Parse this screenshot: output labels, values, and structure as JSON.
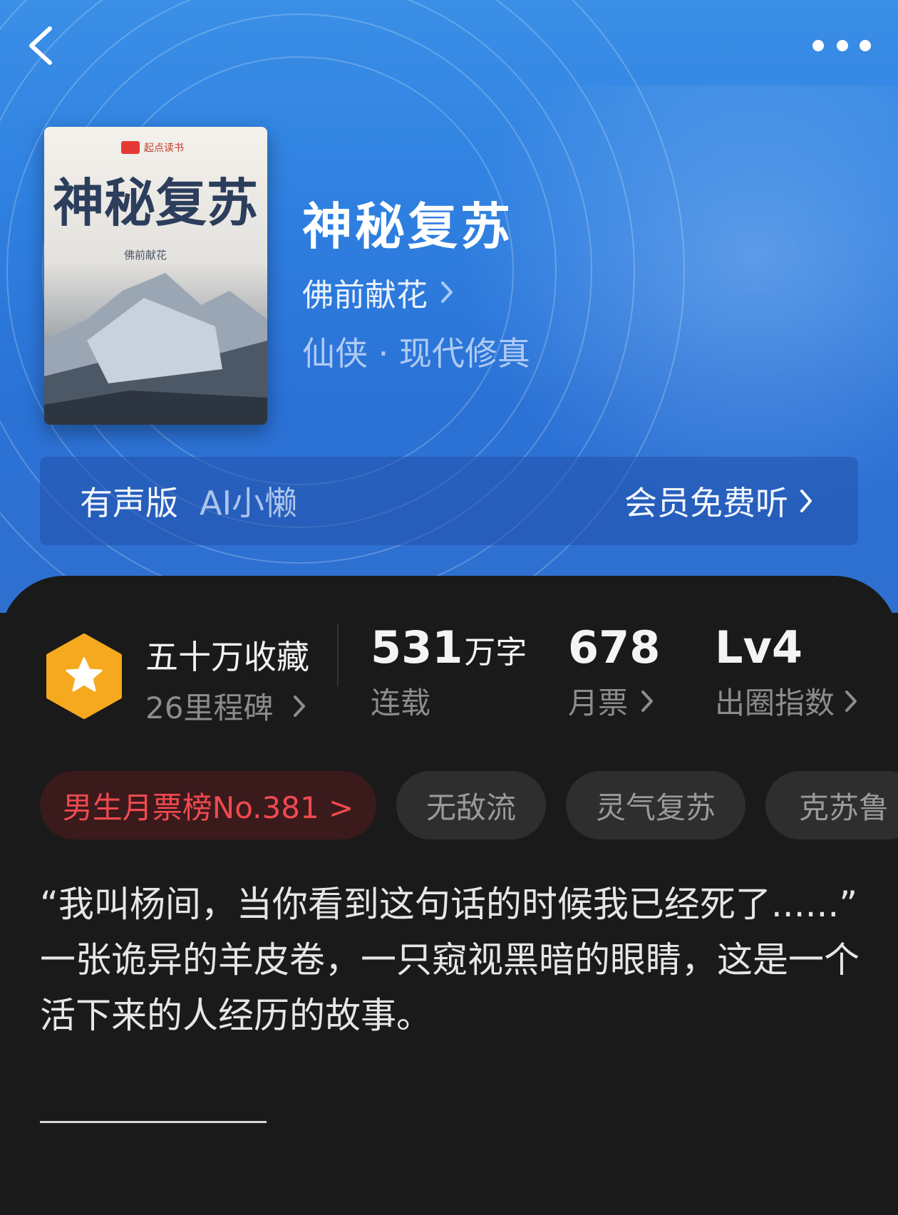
{
  "book": {
    "title": "神秘复苏",
    "author": "佛前献花",
    "genre": "仙侠 · 现代修真",
    "cover": {
      "publisher": "起点读书",
      "title": "神秘复苏",
      "author": "佛前献花"
    }
  },
  "audio": {
    "label": "有声版",
    "voice": "AI小懒",
    "action": "会员免费听"
  },
  "stats": {
    "collect_title": "五十万收藏",
    "milestones": "26里程碑",
    "words_num": "531",
    "words_unit": "万字",
    "status": "连载",
    "monthly_tickets": "678",
    "monthly_label": "月票",
    "level": "Lv4",
    "level_label": "出圈指数"
  },
  "tags": [
    "男生月票榜No.381 >",
    "无敌流",
    "灵气复苏",
    "克苏鲁"
  ],
  "intro": {
    "line1": "“我叫杨间，当你看到这句话的时候我已经死了......”",
    "line2": "一张诡异的羊皮卷，一只窥视黑暗的眼睛，这是一个活下来的人经历的故事。",
    "rule": "——————"
  },
  "colors": {
    "hero_blue": "#2e7fe0",
    "panel_bg": "#1a1a1a",
    "rank_red": "#f04a4f",
    "badge_gold": "#f6a91e"
  },
  "icons": [
    "back-arrow-icon",
    "more-dots-icon",
    "star-badge-icon",
    "chevron-right-icon"
  ]
}
